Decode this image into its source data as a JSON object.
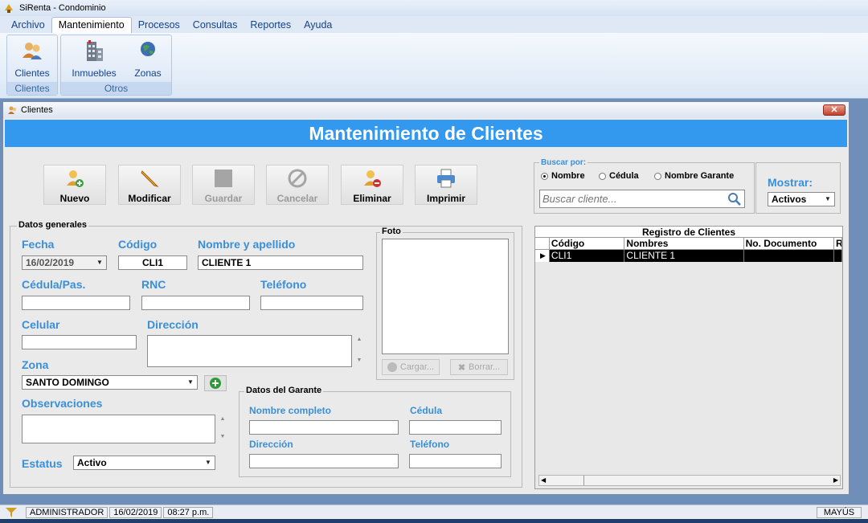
{
  "app": {
    "title": "SiRenta - Condominio"
  },
  "menu": [
    "Archivo",
    "Mantenimiento",
    "Procesos",
    "Consultas",
    "Reportes",
    "Ayuda"
  ],
  "ribbon": {
    "groups": [
      {
        "label": "Clientes",
        "buttons": [
          "Clientes"
        ]
      },
      {
        "label": "Otros",
        "buttons": [
          "Inmuebles",
          "Zonas"
        ]
      }
    ]
  },
  "window": {
    "title": "Clientes",
    "close": "✕",
    "banner": "Mantenimiento de Clientes"
  },
  "toolbar": {
    "nuevo": "Nuevo",
    "modificar": "Modificar",
    "guardar": "Guardar",
    "cancelar": "Cancelar",
    "eliminar": "Eliminar",
    "imprimir": "Imprimir"
  },
  "general": {
    "legend": "Datos generales",
    "fecha_label": "Fecha",
    "fecha_value": "16/02/2019",
    "codigo_label": "Código",
    "codigo_value": "CLI1",
    "nombre_label": "Nombre y apellido",
    "nombre_value": "CLIENTE 1",
    "cedula_label": "Cédula/Pas.",
    "rnc_label": "RNC",
    "telefono_label": "Teléfono",
    "celular_label": "Celular",
    "direccion_label": "Dirección",
    "zona_label": "Zona",
    "zona_value": "SANTO DOMINGO",
    "observaciones_label": "Observaciones",
    "estatus_label": "Estatus",
    "estatus_value": "Activo"
  },
  "foto": {
    "legend": "Foto",
    "cargar": "Cargar...",
    "borrar": "Borrar..."
  },
  "garante": {
    "legend": "Datos del Garante",
    "nombre_label": "Nombre completo",
    "cedula_label": "Cédula",
    "direccion_label": "Dirección",
    "telefono_label": "Teléfono"
  },
  "search": {
    "legend": "Buscar por:",
    "options": [
      "Nombre",
      "Cédula",
      "Nombre Garante"
    ],
    "selected": "Nombre",
    "placeholder": "Buscar cliente...",
    "mostrar_label": "Mostrar:",
    "mostrar_value": "Activos"
  },
  "grid": {
    "caption": "Registro de Clientes",
    "columns": [
      "Código",
      "Nombres",
      "No. Documento",
      "R"
    ],
    "rows": [
      {
        "codigo": "CLI1",
        "nombres": "CLIENTE 1",
        "documento": "",
        "r": ""
      }
    ]
  },
  "status": {
    "user": "ADMINISTRADOR",
    "date": "16/02/2019",
    "time": "08:27 p.m.",
    "caps": "MAYÚS"
  }
}
